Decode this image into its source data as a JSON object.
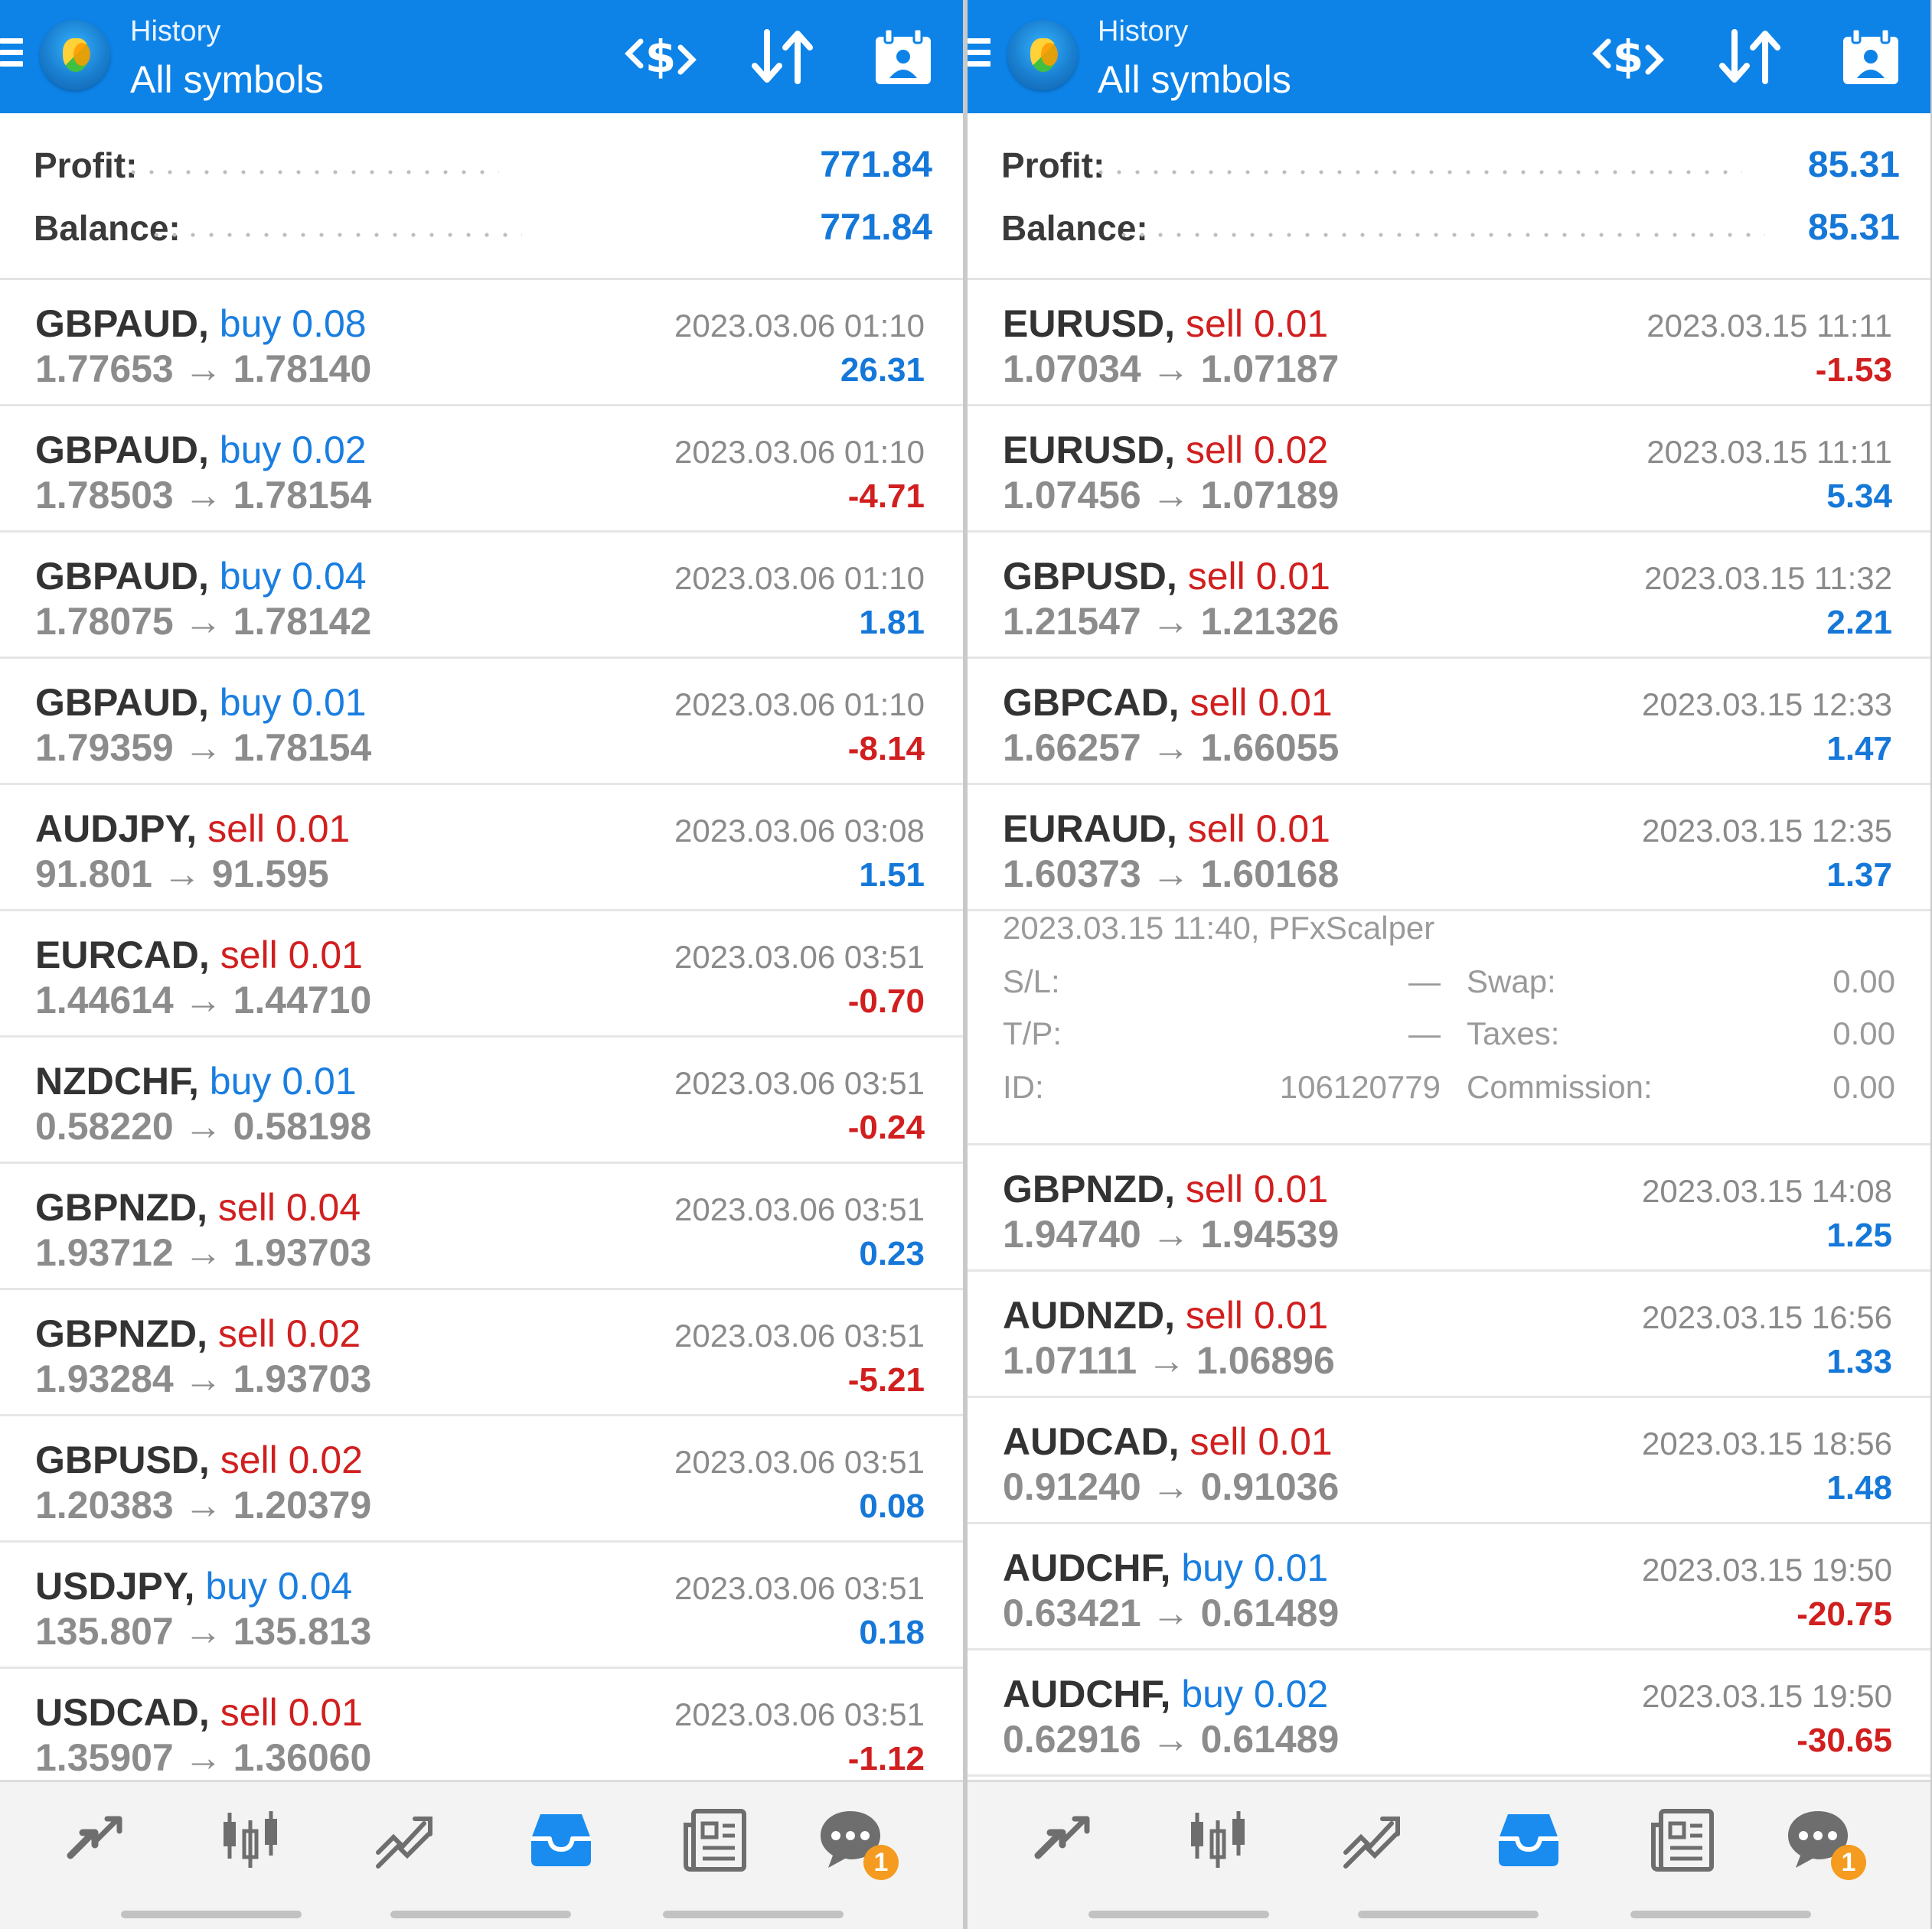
{
  "screens": [
    {
      "header": {
        "title_small": "History",
        "title_big": "All symbols"
      },
      "summary": {
        "profit_label": "Profit:",
        "profit_value": "771.84",
        "balance_label": "Balance:",
        "balance_value": "771.84"
      },
      "deals": [
        {
          "symbol": "GBPAUD,",
          "direction": "buy",
          "lot": "0.08",
          "open": "1.77653",
          "close": "1.78140",
          "time": "2023.03.06 01:10",
          "pl": "26.31",
          "pl_sign": "pos"
        },
        {
          "symbol": "GBPAUD,",
          "direction": "buy",
          "lot": "0.02",
          "open": "1.78503",
          "close": "1.78154",
          "time": "2023.03.06 01:10",
          "pl": "-4.71",
          "pl_sign": "neg"
        },
        {
          "symbol": "GBPAUD,",
          "direction": "buy",
          "lot": "0.04",
          "open": "1.78075",
          "close": "1.78142",
          "time": "2023.03.06 01:10",
          "pl": "1.81",
          "pl_sign": "pos"
        },
        {
          "symbol": "GBPAUD,",
          "direction": "buy",
          "lot": "0.01",
          "open": "1.79359",
          "close": "1.78154",
          "time": "2023.03.06 01:10",
          "pl": "-8.14",
          "pl_sign": "neg"
        },
        {
          "symbol": "AUDJPY,",
          "direction": "sell",
          "lot": "0.01",
          "open": "91.801",
          "close": "91.595",
          "time": "2023.03.06 03:08",
          "pl": "1.51",
          "pl_sign": "pos"
        },
        {
          "symbol": "EURCAD,",
          "direction": "sell",
          "lot": "0.01",
          "open": "1.44614",
          "close": "1.44710",
          "time": "2023.03.06 03:51",
          "pl": "-0.70",
          "pl_sign": "neg"
        },
        {
          "symbol": "NZDCHF,",
          "direction": "buy",
          "lot": "0.01",
          "open": "0.58220",
          "close": "0.58198",
          "time": "2023.03.06 03:51",
          "pl": "-0.24",
          "pl_sign": "neg"
        },
        {
          "symbol": "GBPNZD,",
          "direction": "sell",
          "lot": "0.04",
          "open": "1.93712",
          "close": "1.93703",
          "time": "2023.03.06 03:51",
          "pl": "0.23",
          "pl_sign": "pos"
        },
        {
          "symbol": "GBPNZD,",
          "direction": "sell",
          "lot": "0.02",
          "open": "1.93284",
          "close": "1.93703",
          "time": "2023.03.06 03:51",
          "pl": "-5.21",
          "pl_sign": "neg"
        },
        {
          "symbol": "GBPUSD,",
          "direction": "sell",
          "lot": "0.02",
          "open": "1.20383",
          "close": "1.20379",
          "time": "2023.03.06 03:51",
          "pl": "0.08",
          "pl_sign": "pos"
        },
        {
          "symbol": "USDJPY,",
          "direction": "buy",
          "lot": "0.04",
          "open": "135.807",
          "close": "135.813",
          "time": "2023.03.06 03:51",
          "pl": "0.18",
          "pl_sign": "pos"
        },
        {
          "symbol": "USDCAD,",
          "direction": "sell",
          "lot": "0.01",
          "open": "1.35907",
          "close": "1.36060",
          "time": "2023.03.06 03:51",
          "pl": "-1.12",
          "pl_sign": "neg"
        }
      ],
      "nav": {
        "badge": "1"
      }
    },
    {
      "header": {
        "title_small": "History",
        "title_big": "All symbols"
      },
      "summary": {
        "profit_label": "Profit:",
        "profit_value": "85.31",
        "balance_label": "Balance:",
        "balance_value": "85.31"
      },
      "deals": [
        {
          "symbol": "EURUSD,",
          "direction": "sell",
          "lot": "0.01",
          "open": "1.07034",
          "close": "1.07187",
          "time": "2023.03.15 11:11",
          "pl": "-1.53",
          "pl_sign": "neg"
        },
        {
          "symbol": "EURUSD,",
          "direction": "sell",
          "lot": "0.02",
          "open": "1.07456",
          "close": "1.07189",
          "time": "2023.03.15 11:11",
          "pl": "5.34",
          "pl_sign": "pos"
        },
        {
          "symbol": "GBPUSD,",
          "direction": "sell",
          "lot": "0.01",
          "open": "1.21547",
          "close": "1.21326",
          "time": "2023.03.15 11:32",
          "pl": "2.21",
          "pl_sign": "pos"
        },
        {
          "symbol": "GBPCAD,",
          "direction": "sell",
          "lot": "0.01",
          "open": "1.66257",
          "close": "1.66055",
          "time": "2023.03.15 12:33",
          "pl": "1.47",
          "pl_sign": "pos"
        },
        {
          "symbol": "EURAUD,",
          "direction": "sell",
          "lot": "0.01",
          "open": "1.60373",
          "close": "1.60168",
          "time": "2023.03.15 12:35",
          "pl": "1.37",
          "pl_sign": "pos"
        },
        {
          "symbol": "GBPNZD,",
          "direction": "sell",
          "lot": "0.01",
          "open": "1.94740",
          "close": "1.94539",
          "time": "2023.03.15 14:08",
          "pl": "1.25",
          "pl_sign": "pos"
        },
        {
          "symbol": "AUDNZD,",
          "direction": "sell",
          "lot": "0.01",
          "open": "1.07111",
          "close": "1.06896",
          "time": "2023.03.15 16:56",
          "pl": "1.33",
          "pl_sign": "pos"
        },
        {
          "symbol": "AUDCAD,",
          "direction": "sell",
          "lot": "0.01",
          "open": "0.91240",
          "close": "0.91036",
          "time": "2023.03.15 18:56",
          "pl": "1.48",
          "pl_sign": "pos"
        },
        {
          "symbol": "AUDCHF,",
          "direction": "buy",
          "lot": "0.01",
          "open": "0.63421",
          "close": "0.61489",
          "time": "2023.03.15 19:50",
          "pl": "-20.75",
          "pl_sign": "neg"
        },
        {
          "symbol": "AUDCHF,",
          "direction": "buy",
          "lot": "0.02",
          "open": "0.62916",
          "close": "0.61489",
          "time": "2023.03.15 19:50",
          "pl": "-30.65",
          "pl_sign": "neg"
        }
      ],
      "detail": {
        "header": "2023.03.15 11:40, PFxScalper",
        "sl_label": "S/L:",
        "sl_value": "—",
        "tp_label": "T/P:",
        "tp_value": "—",
        "id_label": "ID:",
        "id_value": "106120779",
        "swap_label": "Swap:",
        "swap_value": "0.00",
        "taxes_label": "Taxes:",
        "taxes_value": "0.00",
        "commission_label": "Commission:",
        "commission_value": "0.00"
      },
      "nav": {
        "badge": "1"
      }
    }
  ],
  "ui": {
    "arrow_glyph": "→",
    "icons": {
      "menu": "hamburger-menu-icon",
      "logo": "metatrader-logo-icon",
      "deal": "deal-currency-icon",
      "sort": "sort-icon",
      "calendar": "calendar-icon",
      "nav": [
        "quotes-icon",
        "chart-icon",
        "trade-icon",
        "history-icon",
        "news-icon",
        "chat-icon"
      ]
    },
    "colors": {
      "header": "#0d83e8",
      "buy": "#1a7ee0",
      "sell": "#d11f1f",
      "positive": "#1578d9",
      "negative": "#d11f1f",
      "badge": "#f59b1f",
      "active_nav": "#1a8cf0"
    }
  }
}
